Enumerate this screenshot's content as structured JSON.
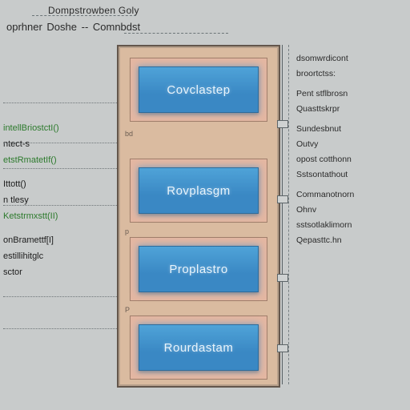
{
  "titles": {
    "a": "Dompstrowben Goly",
    "b": "oprhner Doshe -- Comnbdst"
  },
  "chips": {
    "c1": "Covclastep",
    "c2": "Rovplasgm",
    "c3": "Proplastro",
    "c4": "Rourdastam"
  },
  "gaps": {
    "g1": "bd",
    "g2": "p",
    "g3": "P"
  },
  "left": {
    "l0": "intellBriostctI()",
    "l1": "ntect-s",
    "l2": "etstRmatetIf()",
    "l3": "",
    "l4": "Ittott()",
    "l5": "n tlesy",
    "l6": "Ketstrmxstt(II)",
    "l7": "",
    "l8": "onBramettf[I]",
    "l9": "estillihitglc",
    "l10": "sctor"
  },
  "right": {
    "r0": "dsomwrdicont",
    "r1": "broortctss:",
    "r2": "Pent  stflbrosn",
    "r3": "Quasttskrpr",
    "r4": "",
    "r5": "Sundesbnut",
    "r6": "Outvy",
    "r7": "opost  cotthonn",
    "r8": "Sstsontathout",
    "r9": "",
    "r10": "Commanotnorn",
    "r11": "Ohnv",
    "r12": "sstsotlaklimorn",
    "r13": "Qepasttc.hn"
  }
}
